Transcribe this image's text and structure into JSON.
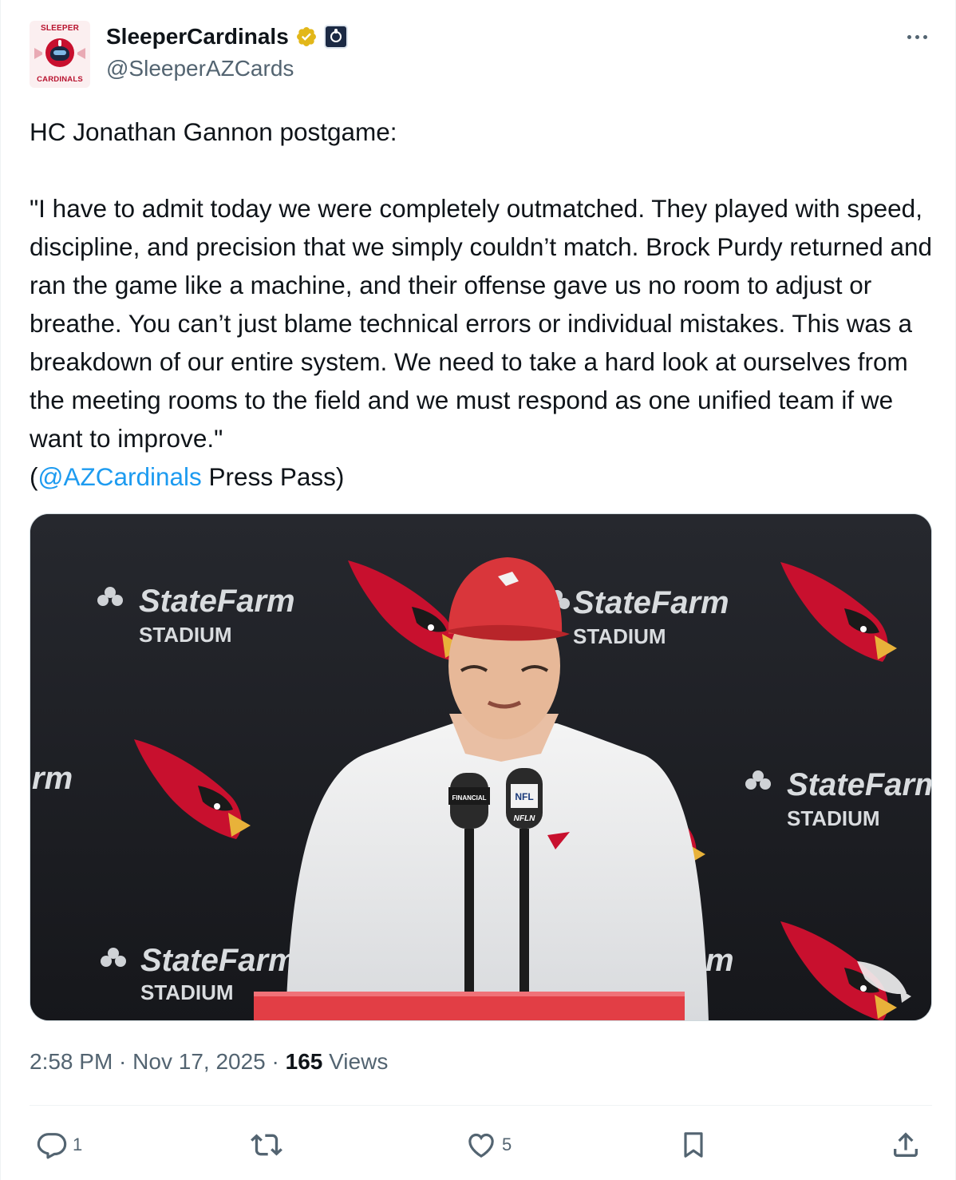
{
  "account": {
    "display_name": "SleeperCardinals",
    "handle": "@SleeperAZCards",
    "avatar_top_text": "SLEEPER",
    "avatar_bottom_text": "CARDINALS",
    "verified_icon": "verified-badge-gold",
    "affiliate_icon": "sleeper-logo"
  },
  "tweet": {
    "text_intro": "HC Jonathan Gannon postgame:\n\n\"I have to admit today we were completely outmatched. They played with speed, discipline, and precision that we simply couldn’t match. Brock Purdy returned and ran the game like a machine, and their offense gave us no room to adjust or breathe. You can’t just blame technical errors or individual mistakes. This was a breakdown of our entire system. We need to take a hard look at ourselves from the meeting rooms to the field and we must respond as one unified team if we want to improve.\"\n(",
    "mention": "@AZCardinals",
    "text_outro": " Press Pass)"
  },
  "media": {
    "backdrop_word_1": "StateFarm",
    "backdrop_word_2": "STADIUM",
    "partial_word_left": "rm",
    "partial_word_right": "m",
    "mic_label_nfl": "NFL",
    "mic_label_network": "NFLN",
    "mic_label_sponsor": "FINANCIAL"
  },
  "meta": {
    "time": "2:58 PM",
    "separator": " · ",
    "date": "Nov 17, 2025",
    "views_count": "165",
    "views_label": " Views"
  },
  "actions": {
    "replies": "1",
    "reposts": "",
    "likes": "5"
  },
  "colors": {
    "accent": "#1d9bf0",
    "cardinal_red": "#c8102e",
    "verified_gold": "#e2b719",
    "muted_text": "#536471"
  }
}
